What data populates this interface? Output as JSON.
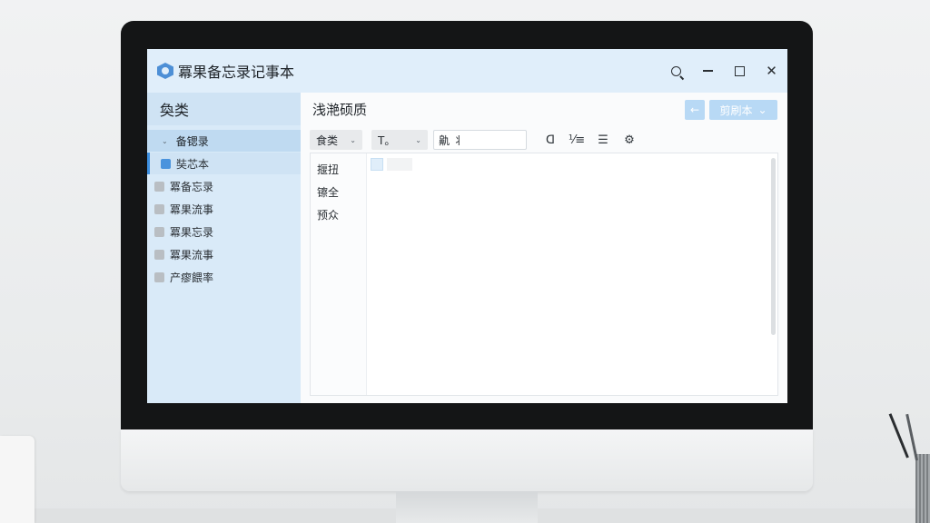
{
  "app": {
    "title": "冪果备忘录记事本"
  },
  "window_controls": {
    "search_icon": "search-icon",
    "minimize_icon": "minimize-icon",
    "maximize_icon": "maximize-icon",
    "close_icon": "close-icon",
    "close_glyph": "✕"
  },
  "sidebar": {
    "heading": "奐类",
    "group": {
      "chevron": "⌄",
      "label": "备锶录"
    },
    "items": [
      {
        "label": "奘芯本"
      },
      {
        "label": "冪备忘录"
      },
      {
        "label": "冪果流事"
      },
      {
        "label": "冪果忘录"
      },
      {
        "label": "冪果流事"
      },
      {
        "label": "产瘳餵率"
      }
    ]
  },
  "main": {
    "title": "浅滟硕质",
    "back_button": "←",
    "new_button": {
      "label": "剪刷本",
      "chevron": "⌄"
    }
  },
  "toolbar": {
    "category_select": {
      "value": "食类",
      "chevron": "⌄"
    },
    "font_select": {
      "value": "T。",
      "chevron": "⌄"
    },
    "search_field": {
      "value": "鼽 ⺦"
    },
    "tool_icons": [
      "ᗡ",
      "⅟≡",
      "☰",
      "⚙"
    ]
  },
  "panel": {
    "left_items": [
      {
        "label": "揠扭"
      },
      {
        "label": "镲全"
      },
      {
        "label": "预众"
      }
    ]
  },
  "colors": {
    "titlebar": "#e0eefa",
    "sidebar": "#d9eaf8",
    "accent": "#3d8fe0",
    "button": "#b8d9f5"
  }
}
